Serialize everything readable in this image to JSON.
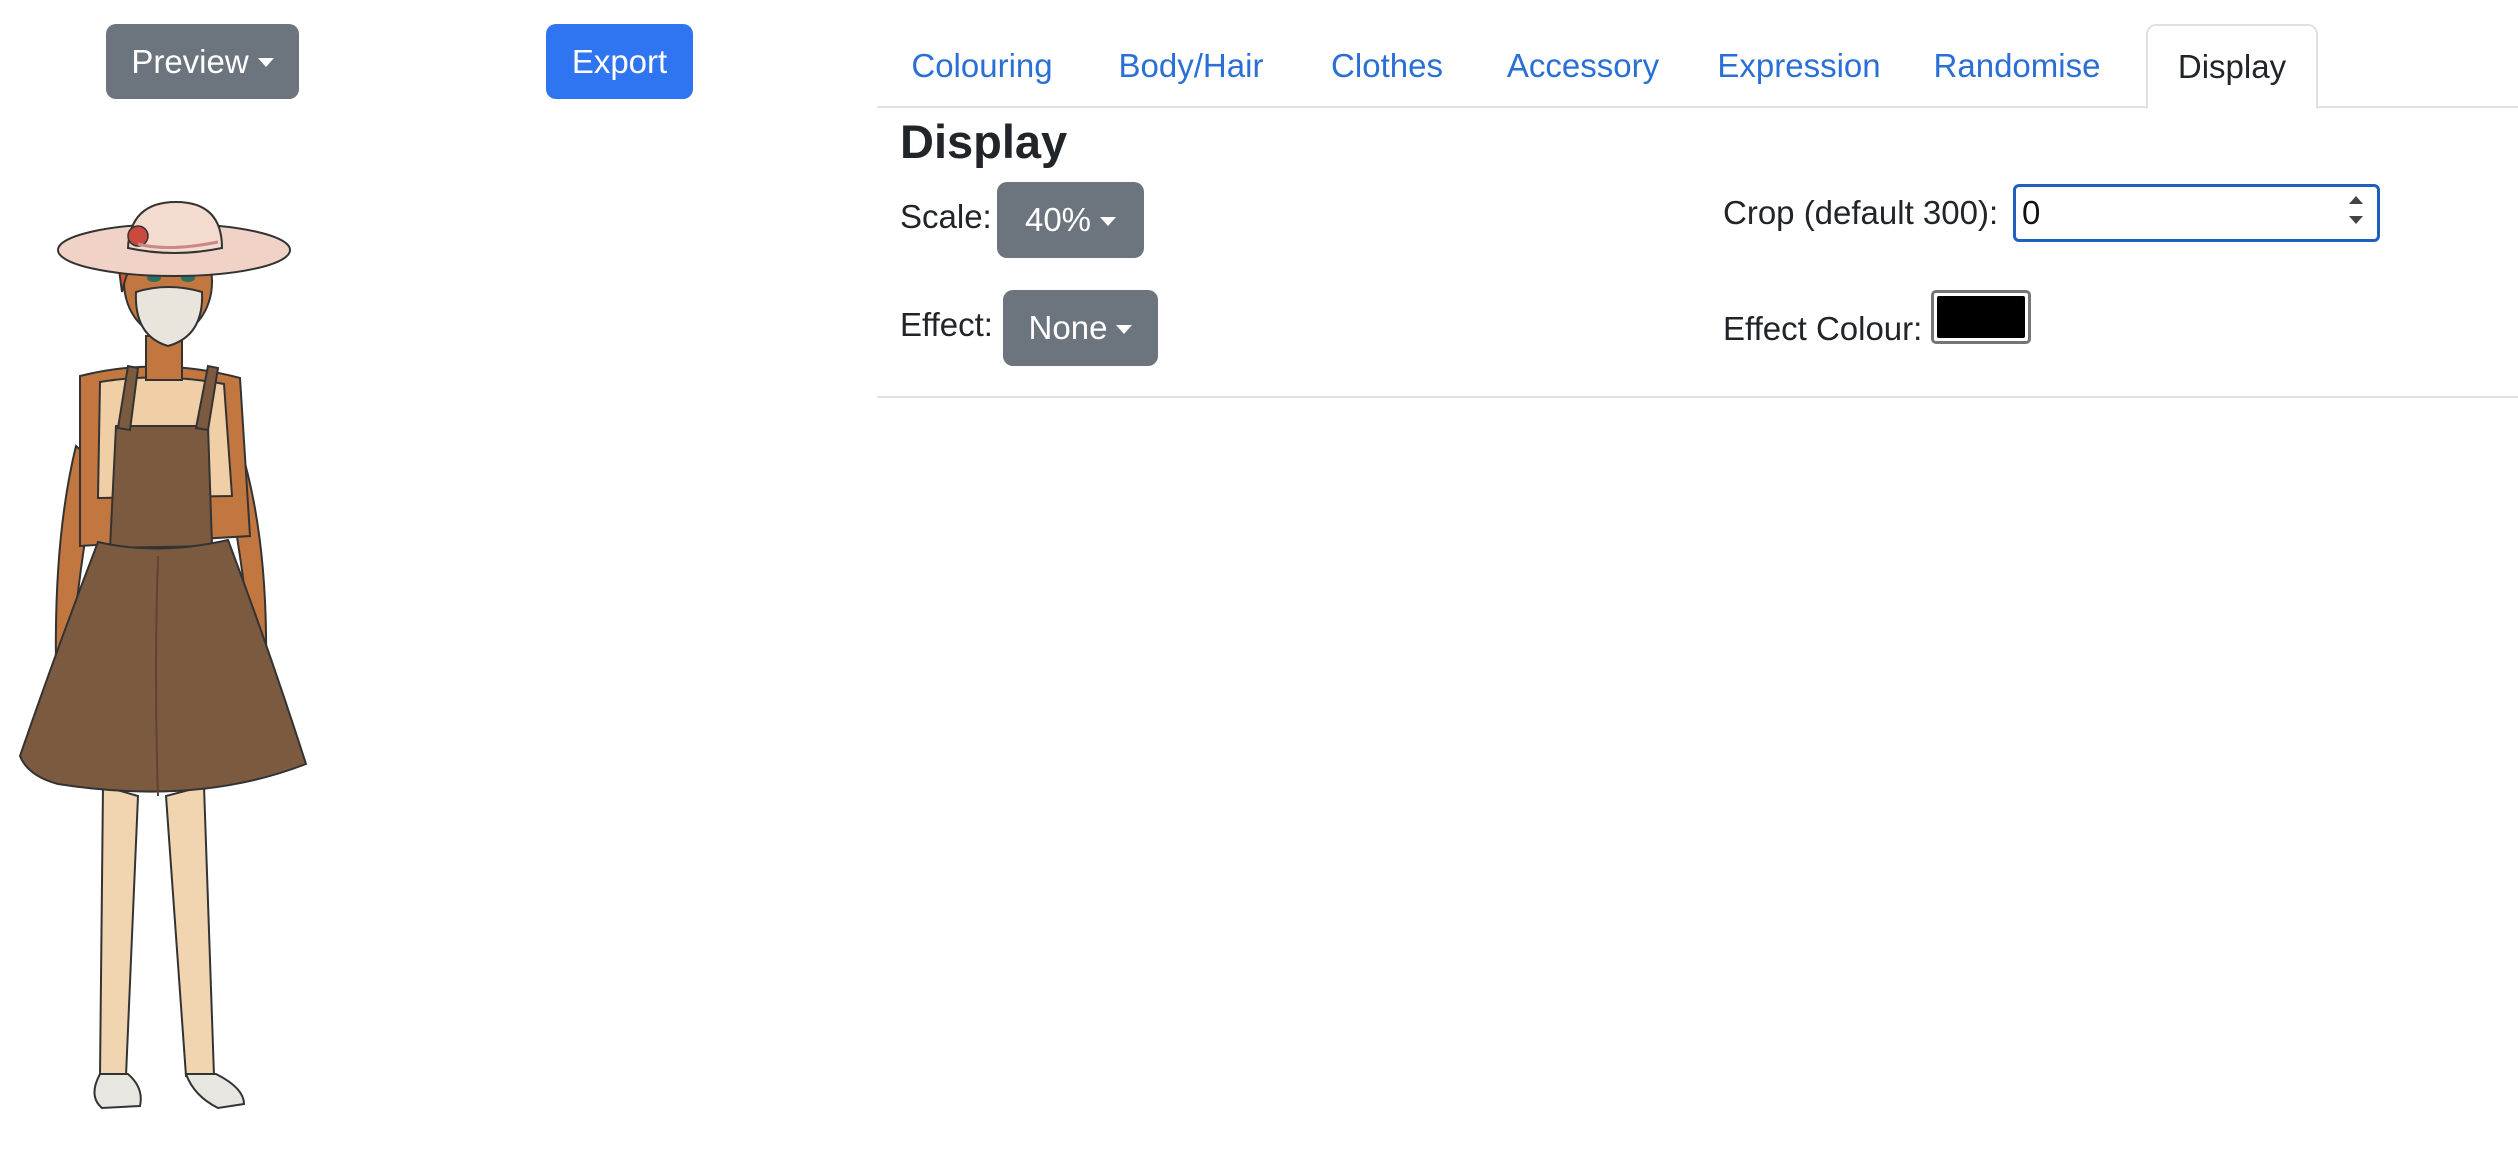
{
  "toolbar": {
    "preview_label": "Preview",
    "export_label": "Export"
  },
  "tabs": [
    {
      "label": "Colouring",
      "active": false
    },
    {
      "label": "Body/Hair",
      "active": false
    },
    {
      "label": "Clothes",
      "active": false
    },
    {
      "label": "Accessory",
      "active": false
    },
    {
      "label": "Expression",
      "active": false
    },
    {
      "label": "Randomise",
      "active": false
    },
    {
      "label": "Display",
      "active": true
    }
  ],
  "display": {
    "title": "Display",
    "scale_label": "Scale:",
    "scale_value": "40%",
    "effect_label": "Effect:",
    "effect_value": "None",
    "crop_label": "Crop (default 300):",
    "crop_value": "0",
    "effect_colour_label": "Effect Colour:",
    "effect_colour": "#000000"
  },
  "colors": {
    "primary": "#2f74f0",
    "secondary": "#6c757d",
    "link": "#2a6fd6"
  },
  "icons": {
    "dropdown_caret": "chevron-down-icon",
    "spinner": "number-spinner-icon"
  }
}
